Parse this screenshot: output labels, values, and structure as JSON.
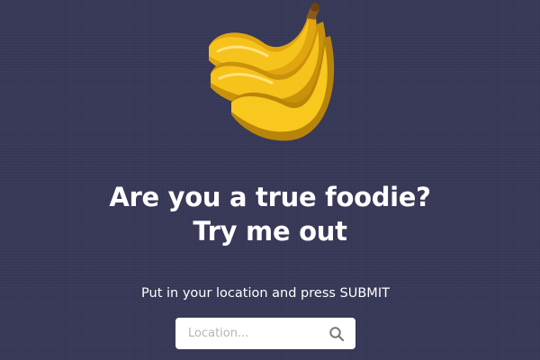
{
  "hero": {
    "image_icon": "banana-bunch-icon"
  },
  "headline": {
    "line1": "Are you a true foodie?",
    "line2": "Try me out"
  },
  "instruction": "Put in your location and press SUBMIT",
  "search": {
    "placeholder": "Location...",
    "value": "",
    "icon": "search-icon"
  },
  "colors": {
    "background": "#363656",
    "banana": "#f6c21c",
    "banana_shadow": "#c9920a",
    "stem": "#8a5a1a"
  }
}
